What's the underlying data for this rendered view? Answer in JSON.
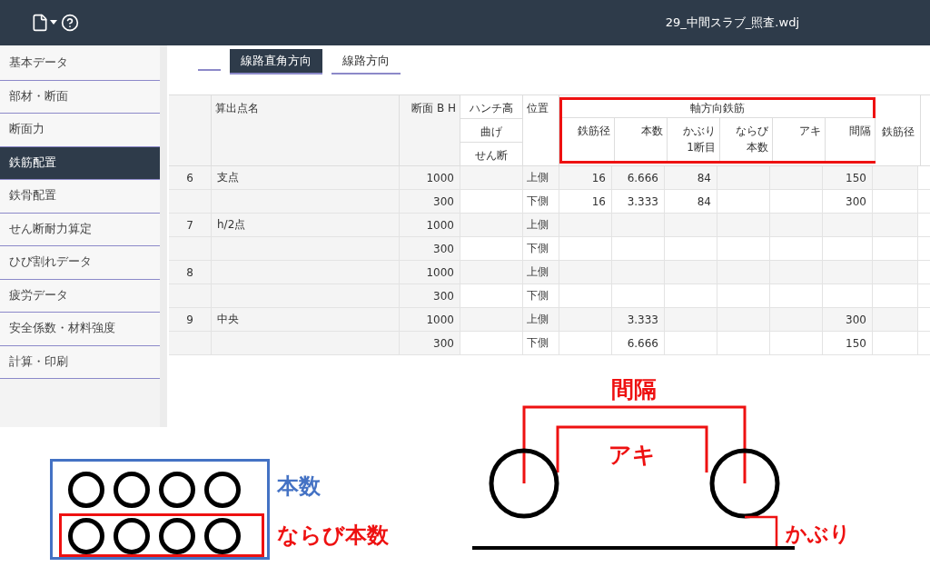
{
  "window": {
    "title": "29_中間スラブ_照査.wdj"
  },
  "sidebar": {
    "items": [
      {
        "label": "基本データ",
        "selected": false
      },
      {
        "label": "部材・断面",
        "selected": false
      },
      {
        "label": "断面力",
        "selected": false
      },
      {
        "label": "鉄筋配置",
        "selected": true
      },
      {
        "label": "鉄骨配置",
        "selected": false
      },
      {
        "label": "せん断耐力算定",
        "selected": false
      },
      {
        "label": "ひび割れデータ",
        "selected": false
      },
      {
        "label": "疲労データ",
        "selected": false
      },
      {
        "label": "安全係数・材料強度",
        "selected": false
      },
      {
        "label": "計算・印刷",
        "selected": false
      }
    ]
  },
  "tabs": [
    {
      "label": "線路直角方向",
      "selected": true
    },
    {
      "label": "線路方向",
      "selected": false
    }
  ],
  "table": {
    "columns": {
      "name": "算出点名",
      "section": "断面 B H",
      "haunch": [
        "ハンチ高",
        "曲げ",
        "せん断"
      ],
      "position": "位置",
      "group": "軸方向鉄筋",
      "group_columns": {
        "rebar_diameter": "鉄筋径",
        "count": "本数",
        "cover_first": "かぶり1断目",
        "row_count": "ならび本数",
        "clear_gap": "アキ",
        "pitch": "間隔"
      },
      "column_13": "鉄筋径"
    },
    "rows": [
      {
        "no": "6",
        "name": "支点",
        "section": "1000",
        "position": "上側",
        "rebar_diameter": "16",
        "count": "6.666",
        "cover_first": "84",
        "pitch": "150"
      },
      {
        "section": "300",
        "position": "下側",
        "rebar_diameter": "16",
        "count": "3.333",
        "cover_first": "84",
        "pitch": "300"
      },
      {
        "no": "7",
        "name": "h/2点",
        "section": "1000",
        "position": "上側"
      },
      {
        "section": "300",
        "position": "下側"
      },
      {
        "no": "8",
        "section": "1000",
        "position": "上側"
      },
      {
        "section": "300",
        "position": "下側"
      },
      {
        "no": "9",
        "name": "中央",
        "section": "1000",
        "position": "上側",
        "count": "3.333",
        "pitch": "300"
      },
      {
        "section": "300",
        "position": "下側",
        "count": "6.666",
        "pitch": "150"
      }
    ]
  },
  "legend": {
    "count_label": "本数",
    "row_count_label": "ならび本数"
  },
  "spacing_diagram": {
    "pitch_label": "間隔",
    "gap_label": "アキ",
    "cover_label": "かぶり"
  }
}
